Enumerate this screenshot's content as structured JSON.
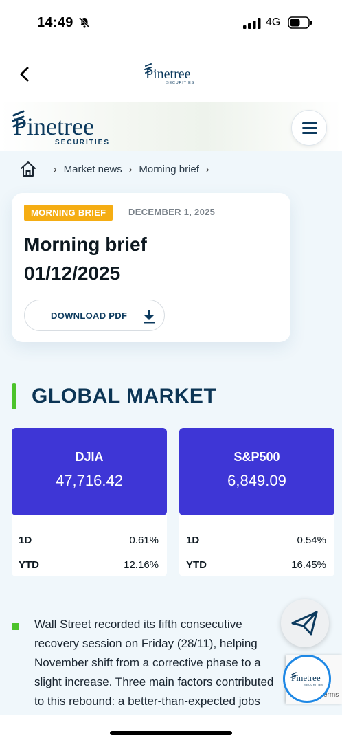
{
  "status_bar": {
    "time": "14:49",
    "network": "4G"
  },
  "header": {
    "logo_text": "Pinetree",
    "logo_sub": "SECURITIES"
  },
  "site_nav": {
    "logo_text": "Pinetree",
    "logo_sub": "SECURITIES"
  },
  "breadcrumb": {
    "items": [
      "Market news",
      "Morning brief"
    ]
  },
  "card": {
    "tag": "MORNING BRIEF",
    "date": "DECEMBER 1, 2025",
    "title_line1": "Morning brief",
    "title_line2": "01/12/2025",
    "download_label": "DOWNLOAD PDF"
  },
  "section": {
    "title": "GLOBAL MARKET"
  },
  "indices": [
    {
      "name": "DJIA",
      "value": "47,716.42",
      "d1_label": "1D",
      "d1": "0.61%",
      "ytd_label": "YTD",
      "ytd": "12.16%"
    },
    {
      "name": "S&P500",
      "value": "6,849.09",
      "d1_label": "1D",
      "d1": "0.54%",
      "ytd_label": "YTD",
      "ytd": "16.45%"
    }
  ],
  "article": {
    "lines": [
      "Wall Street recorded its fifth consecutive",
      "recovery session on Friday (28/11), helping",
      "November shift from a corrective phase to a",
      "slight increase. Three main factors contributed",
      "to this rebound: a better-than-expected jobs"
    ]
  },
  "floating": {
    "recaptcha_terms": "Terms",
    "chat_logo": "Pinetree",
    "chat_logo_sub": "SECURITIES"
  },
  "colors": {
    "brand_navy": "#0c3a5e",
    "accent_green": "#4cc32b",
    "tag_orange": "#f5ad13",
    "index_blue": "#3e36d6"
  }
}
